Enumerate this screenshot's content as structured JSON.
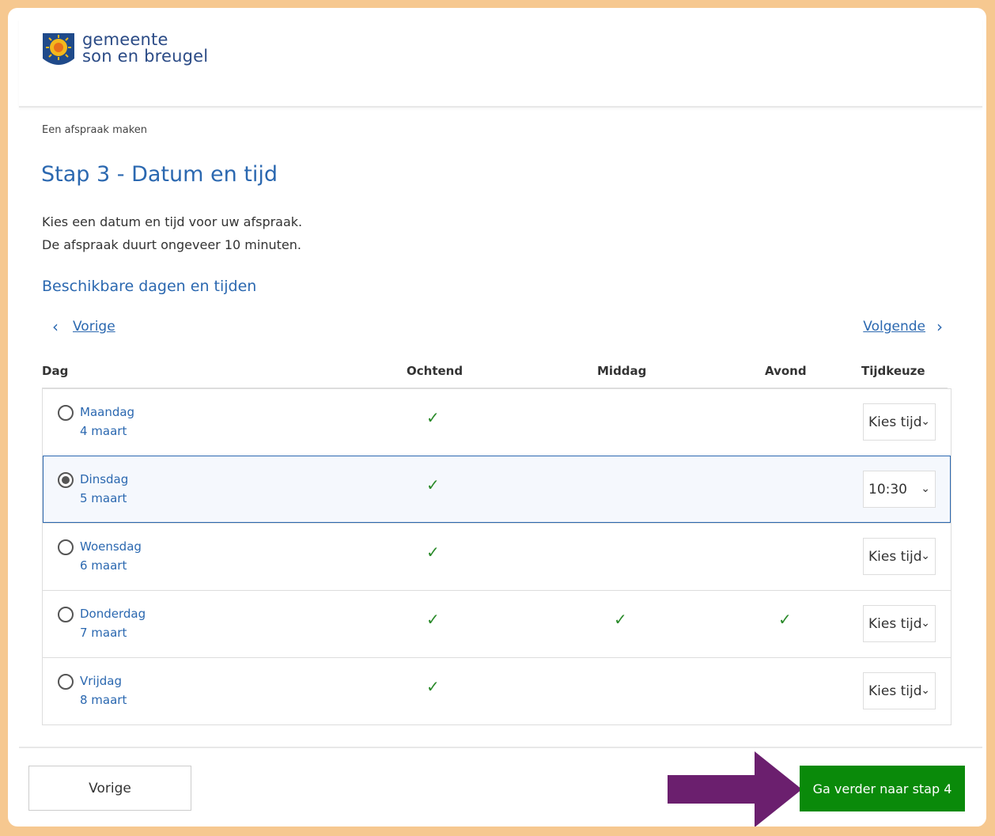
{
  "site": {
    "logo_line1": "gemeente",
    "logo_line2": "son en breugel"
  },
  "breadcrumb": "Een afspraak maken",
  "title": "Stap 3 - Datum en tijd",
  "intro": {
    "line1": "Kies een datum en tijd voor uw afspraak.",
    "line2": "De afspraak duurt ongeveer 10 minuten."
  },
  "section_title": "Beschikbare dagen en tijden",
  "nav": {
    "prev": "Vorige",
    "next": "Volgende"
  },
  "table": {
    "headers": {
      "day": "Dag",
      "morning": "Ochtend",
      "afternoon": "Middag",
      "evening": "Avond",
      "choice": "Tijdkeuze"
    },
    "rows": [
      {
        "day": "Maandag",
        "date": "4 maart",
        "selected": false,
        "time": "Kies tijd",
        "morning": true,
        "afternoon": false,
        "evening": false
      },
      {
        "day": "Dinsdag",
        "date": "5 maart",
        "selected": true,
        "time": "10:30",
        "morning": true,
        "afternoon": false,
        "evening": false
      },
      {
        "day": "Woensdag",
        "date": "6 maart",
        "selected": false,
        "time": "Kies tijd",
        "morning": true,
        "afternoon": false,
        "evening": false
      },
      {
        "day": "Donderdag",
        "date": "7 maart",
        "selected": false,
        "time": "Kies tijd",
        "morning": true,
        "afternoon": true,
        "evening": true
      },
      {
        "day": "Vrijdag",
        "date": "8 maart",
        "selected": false,
        "time": "Kies tijd",
        "morning": true,
        "afternoon": false,
        "evening": false
      }
    ]
  },
  "footer": {
    "back": "Vorige",
    "next": "Ga verder naar stap 4"
  },
  "colors": {
    "accent": "#2b68b0",
    "primary_button": "#0a8a0a",
    "arrow": "#6b1f6e",
    "frame": "#f6c890"
  }
}
